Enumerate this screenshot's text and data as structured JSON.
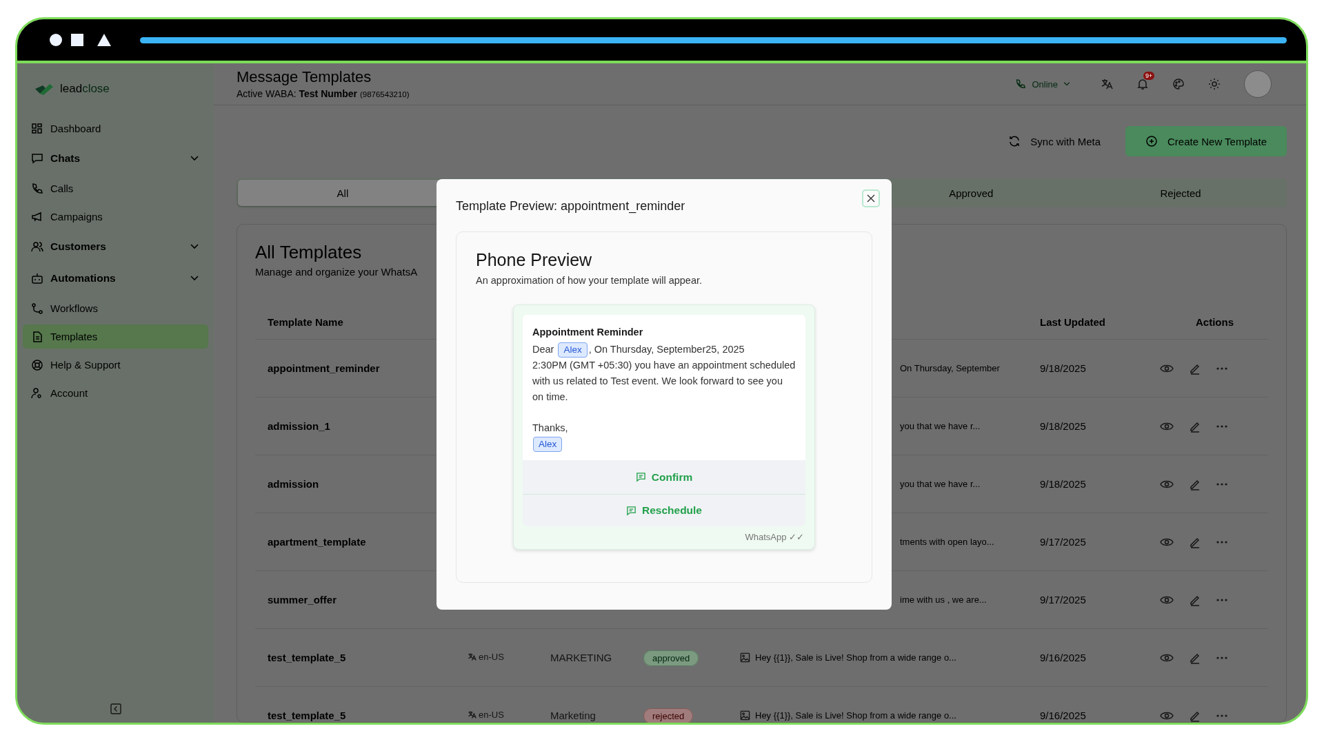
{
  "sidebar": {
    "logo": {
      "part_a": "lead",
      "part_b": "close"
    },
    "items": [
      {
        "label": "Dashboard",
        "expandable": false,
        "selected": false
      },
      {
        "label": "Chats",
        "expandable": true,
        "selected": false
      },
      {
        "label": "Calls",
        "expandable": false,
        "selected": false
      },
      {
        "label": "Campaigns",
        "expandable": false,
        "selected": false
      },
      {
        "label": "Customers",
        "expandable": true,
        "selected": false
      },
      {
        "label": "Automations",
        "expandable": true,
        "selected": false
      },
      {
        "label": "Workflows",
        "expandable": false,
        "selected": false
      },
      {
        "label": "Templates",
        "expandable": false,
        "selected": true
      },
      {
        "label": "Help & Support",
        "expandable": false,
        "selected": false
      },
      {
        "label": "Account",
        "expandable": false,
        "selected": false
      }
    ]
  },
  "header": {
    "title": "Message Templates",
    "waba": "Active WABA: **Test Number**",
    "waba_phone": "(9876543210)",
    "status": "Online",
    "notification_badge": "9+"
  },
  "toolbar": {
    "sync": "Sync with Meta",
    "create": "Create New Template"
  },
  "tabs": [
    {
      "label": "All",
      "selected": true
    },
    {
      "label": "Approved",
      "selected": false
    },
    {
      "label": "Rejected",
      "selected": false
    }
  ],
  "templates_card": {
    "title": "All Templates",
    "subtitle": "Manage and organize your WhatsA"
  },
  "table": {
    "columns": [
      "Template Name",
      "Last Updated",
      "Actions"
    ],
    "rows": [
      {
        "name": "appointment_reminder",
        "content": "On Thursday, September",
        "updated": "9/18/2025"
      },
      {
        "name": "admission_1",
        "content": "you that we have r...",
        "updated": "9/18/2025"
      },
      {
        "name": "admission",
        "content": "you that we have r...",
        "updated": "9/18/2025"
      },
      {
        "name": "apartment_template",
        "content": "tments with open layo...",
        "updated": "9/17/2025"
      },
      {
        "name": "summer_offer",
        "content": "ime with us , we are...",
        "updated": "9/17/2025"
      },
      {
        "name": "test_template_5",
        "language": "en-US",
        "category": "MARKETING",
        "status": {
          "text": "approved",
          "kind": "approved"
        },
        "content": "Hey {{1}}, Sale is Live! Shop from a wide range o...",
        "updated": "9/16/2025"
      },
      {
        "name": "test_template_5",
        "language": "en-US",
        "category": "Marketing",
        "status": {
          "text": "rejected",
          "kind": "rejected"
        },
        "content": "Hey {{1}}, Sale is Live! Shop from a wide range o...",
        "updated": "9/16/2025"
      }
    ]
  },
  "modal": {
    "title": "Template Preview: appointment_reminder",
    "preview_title": "Phone Preview",
    "preview_subtitle": "An approximation of how your template will appear.",
    "message": {
      "header": "Appointment Reminder",
      "paragraphs": [
        [
          {
            "kind": "text",
            "text": "Dear"
          },
          {
            "kind": "variable",
            "text": "Alex"
          },
          {
            "kind": "text",
            "text": ", On Thursday, September25, 2025"
          },
          {
            "kind": "block",
            "text": "2:30PM (GMT +05:30) you have an appointment scheduled with us related to Test event. We look forward to see you on time."
          }
        ],
        [
          {
            "kind": "text",
            "text": "Thanks,"
          }
        ],
        [
          {
            "kind": "variable",
            "text": "Alex"
          }
        ]
      ],
      "buttons": [
        "Confirm",
        "Reschedule"
      ],
      "footer": "WhatsApp ✓✓"
    }
  }
}
